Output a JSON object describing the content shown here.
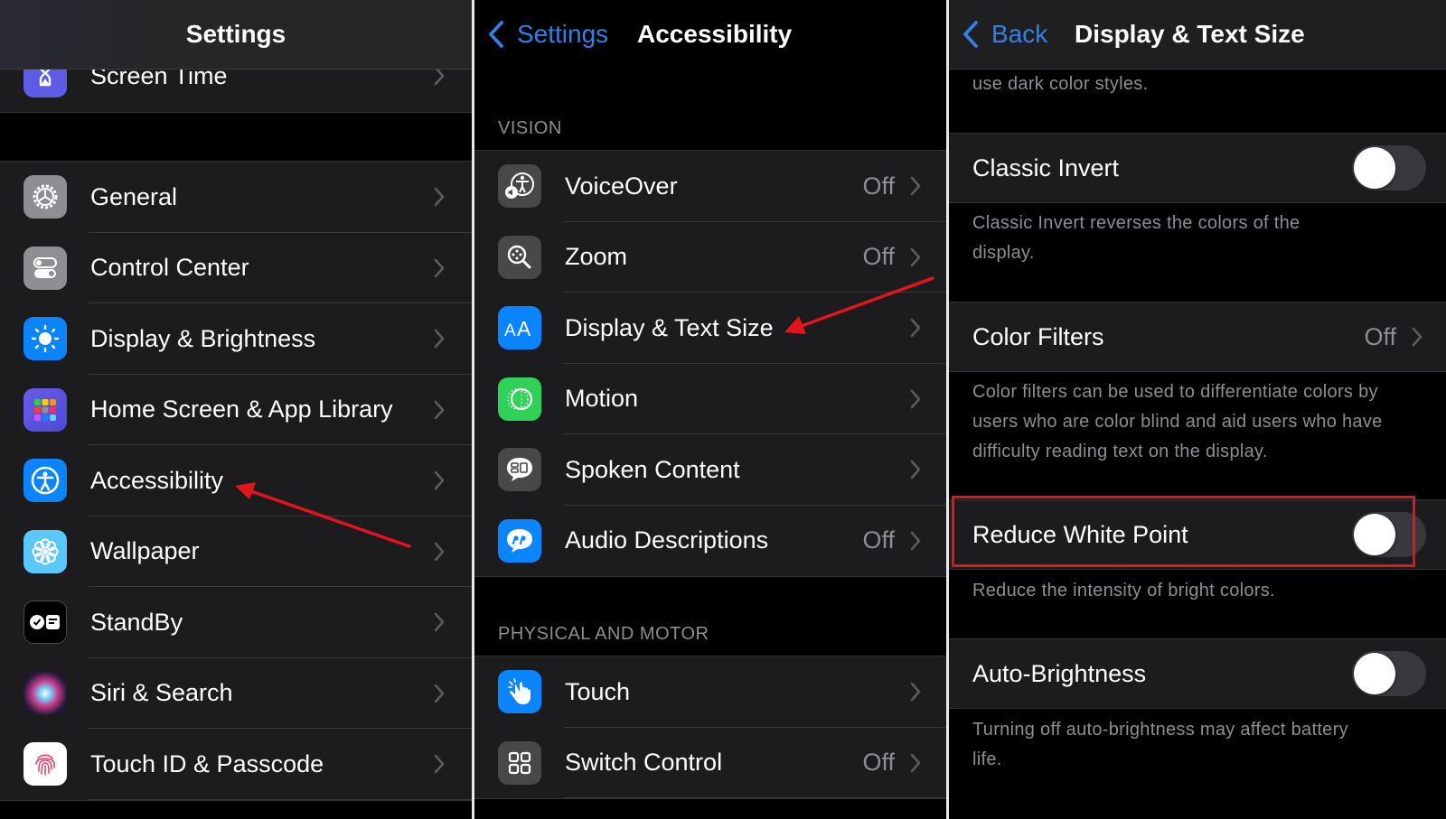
{
  "annotation_colors": {
    "arrow": "#e3141b",
    "highlight_box": "#e3141b"
  },
  "panel1": {
    "title": "Settings",
    "partial_row": {
      "label": "Screen Time",
      "icon": "hourglass-icon",
      "icon_color": "#5e5ce6"
    },
    "items": [
      {
        "label": "General",
        "icon": "gear-icon",
        "icon_color": "#8e8e93"
      },
      {
        "label": "Control Center",
        "icon": "switches-icon",
        "icon_color": "#8e8e93"
      },
      {
        "label": "Display & Brightness",
        "icon": "sun-icon",
        "icon_color": "#0a84ff"
      },
      {
        "label": "Home Screen & App Library",
        "icon": "app-grid-icon",
        "icon_color": "#5e5ce6"
      },
      {
        "label": "Accessibility",
        "icon": "accessibility-icon",
        "icon_color": "#0a84ff"
      },
      {
        "label": "Wallpaper",
        "icon": "flower-icon",
        "icon_color": "#5ac8fa"
      },
      {
        "label": "StandBy",
        "icon": "standby-icon",
        "icon_color": "#000000"
      },
      {
        "label": "Siri & Search",
        "icon": "siri-icon",
        "icon_color": "#1a1a1a"
      },
      {
        "label": "Touch ID & Passcode",
        "icon": "fingerprint-icon",
        "icon_color": "#ffffff"
      }
    ]
  },
  "panel2": {
    "back_label": "Settings",
    "title": "Accessibility",
    "sections": [
      {
        "header": "VISION",
        "items": [
          {
            "label": "VoiceOver",
            "value": "Off",
            "icon": "voiceover-icon",
            "icon_color": "#48484a"
          },
          {
            "label": "Zoom",
            "value": "Off",
            "icon": "zoom-icon",
            "icon_color": "#48484a"
          },
          {
            "label": "Display & Text Size",
            "value": "",
            "icon": "text-size-icon",
            "icon_color": "#0a84ff"
          },
          {
            "label": "Motion",
            "value": "",
            "icon": "motion-icon",
            "icon_color": "#30d158"
          },
          {
            "label": "Spoken Content",
            "value": "",
            "icon": "speech-bubble-icon",
            "icon_color": "#48484a"
          },
          {
            "label": "Audio Descriptions",
            "value": "Off",
            "icon": "quote-bubble-icon",
            "icon_color": "#0a84ff"
          }
        ]
      },
      {
        "header": "PHYSICAL AND MOTOR",
        "items": [
          {
            "label": "Touch",
            "value": "",
            "icon": "hand-tap-icon",
            "icon_color": "#0a84ff"
          },
          {
            "label": "Switch Control",
            "value": "Off",
            "icon": "grid-icon",
            "icon_color": "#48484a"
          }
        ]
      }
    ]
  },
  "panel3": {
    "back_label": "Back",
    "title": "Display & Text Size",
    "top_footer": "use dark color styles.",
    "classic_invert": {
      "label": "Classic Invert",
      "on": false,
      "footer": "Classic Invert reverses the colors of the display."
    },
    "color_filters": {
      "label": "Color Filters",
      "value": "Off",
      "footer": "Color filters can be used to differentiate colors by users who are color blind and aid users who have difficulty reading text on the display."
    },
    "reduce_white_point": {
      "label": "Reduce White Point",
      "on": false,
      "footer": "Reduce the intensity of bright colors."
    },
    "auto_brightness": {
      "label": "Auto-Brightness",
      "on": false,
      "footer": "Turning off auto-brightness may affect battery life."
    }
  }
}
